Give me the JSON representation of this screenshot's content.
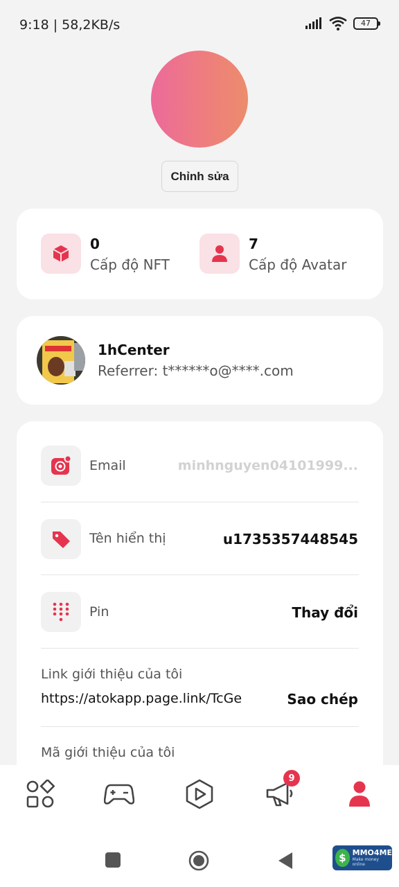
{
  "status_bar": {
    "time": "9:18 | 58,2KB/s",
    "battery": "47"
  },
  "profile": {
    "edit_label": "Chỉnh sửa"
  },
  "levels": [
    {
      "value": "0",
      "label": "Cấp độ NFT",
      "icon": "cube-icon"
    },
    {
      "value": "7",
      "label": "Cấp độ Avatar",
      "icon": "user-icon"
    }
  ],
  "referrer": {
    "name": "1hCenter",
    "email": "Referrer: t******o@****.com"
  },
  "info": {
    "email": {
      "label": "Email",
      "value": "minhnguyen04101999..."
    },
    "display_name": {
      "label": "Tên hiển thị",
      "value": "u1735357448545"
    },
    "pin": {
      "label": "Pin",
      "action": "Thay đổi"
    },
    "link": {
      "label": "Link giới thiệu của tôi",
      "value": "https://atokapp.page.link/TcGe",
      "action": "Sao chép"
    },
    "code": {
      "label": "Mã giới thiệu của tôi"
    }
  },
  "bottom_nav": {
    "items": [
      "apps-icon",
      "gamepad-icon",
      "play-icon",
      "megaphone-icon",
      "profile-icon"
    ],
    "notification_count": "9"
  },
  "watermark": {
    "title": "MMO4ME",
    "subtitle": "Make money online"
  },
  "colors": {
    "accent": "#e5354e",
    "accent_light": "#f9e1e6"
  }
}
